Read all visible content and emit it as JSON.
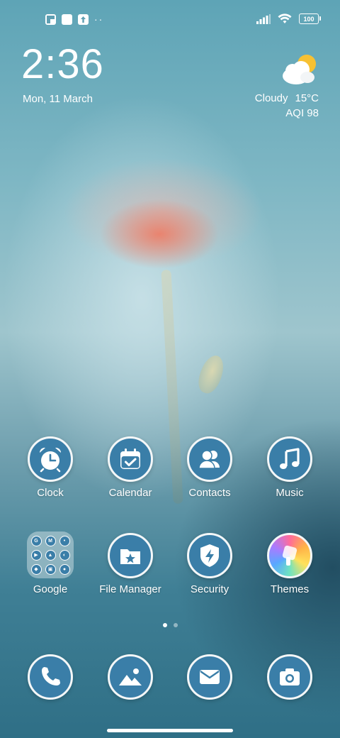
{
  "status_bar": {
    "notification_icons": [
      "flipboard-icon",
      "square-icon",
      "upload-icon"
    ],
    "more_dots": "··",
    "battery": "100"
  },
  "clock_widget": {
    "time": "2:36",
    "date": "Mon, 11 March"
  },
  "weather_widget": {
    "condition": "Cloudy",
    "temperature": "15°C",
    "aqi": "AQI 98",
    "icon": "partly-cloudy-icon"
  },
  "apps": [
    {
      "label": "Clock",
      "icon": "alarm-clock-icon"
    },
    {
      "label": "Calendar",
      "icon": "calendar-check-icon"
    },
    {
      "label": "Contacts",
      "icon": "contacts-icon"
    },
    {
      "label": "Music",
      "icon": "music-note-icon"
    },
    {
      "label": "Google",
      "icon": "folder-icon"
    },
    {
      "label": "File Manager",
      "icon": "star-folder-icon"
    },
    {
      "label": "Security",
      "icon": "shield-bolt-icon"
    },
    {
      "label": "Themes",
      "icon": "themes-brush-icon"
    }
  ],
  "google_folder_apps": [
    "google",
    "gmail",
    "maps",
    "youtube",
    "drive",
    "photos-lens",
    "play",
    "duo",
    "assistant"
  ],
  "pager": {
    "pages": 2,
    "active": 1
  },
  "dock": [
    {
      "icon": "phone-icon"
    },
    {
      "icon": "gallery-icon"
    },
    {
      "icon": "messages-icon"
    },
    {
      "icon": "camera-icon"
    }
  ],
  "colors": {
    "icon_fill": "#3a7ea8",
    "icon_border": "#f4f7f8"
  }
}
